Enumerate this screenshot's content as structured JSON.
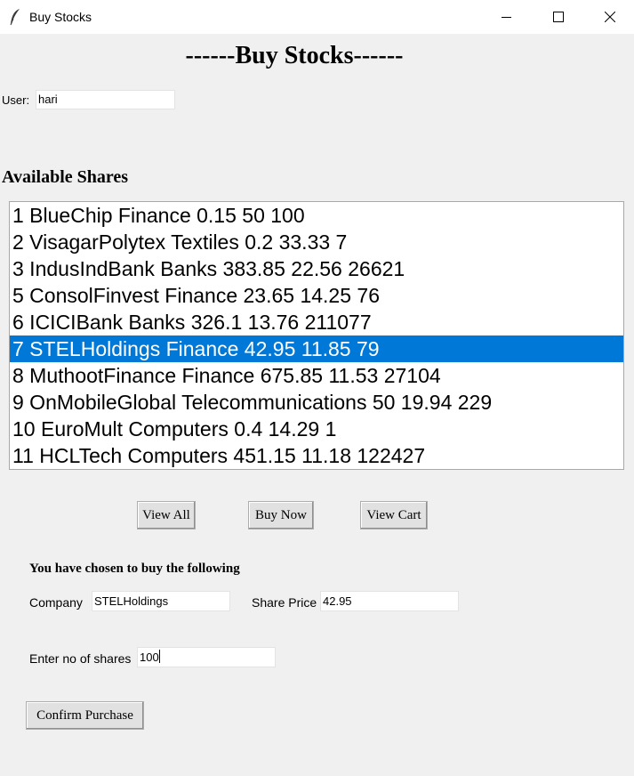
{
  "window": {
    "title": "Buy Stocks",
    "icon": "feather-icon",
    "controls": [
      "minimize-icon",
      "maximize-icon",
      "close-icon"
    ]
  },
  "heading": "------Buy Stocks------",
  "user": {
    "label": "User:",
    "value": "hari"
  },
  "shares": {
    "title": "Available Shares",
    "items": [
      "1 BlueChip Finance 0.15 50 100",
      "2 VisagarPolytex Textiles 0.2 33.33 7",
      "3 IndusIndBank Banks 383.85 22.56 26621",
      "5 ConsolFinvest Finance 23.65 14.25 76",
      "6 ICICIBank Banks 326.1 13.76 211077",
      "7 STELHoldings Finance 42.95 11.85 79",
      "8 MuthootFinance Finance 675.85 11.53 27104",
      "9 OnMobileGlobal Telecommunications 50 19.94 229",
      "10 EuroMult Computers 0.4 14.29 1",
      "11 HCLTech Computers 451.15 11.18 122427"
    ],
    "selected_index": 5,
    "selection_color": "#0078d7"
  },
  "buttons": {
    "view_all": "View All",
    "buy_now": "Buy Now",
    "view_cart": "View Cart",
    "confirm": "Confirm Purchase"
  },
  "purchase": {
    "title": "You have chosen to buy the following",
    "company_label": "Company",
    "company_value": "STELHoldings",
    "price_label": "Share Price",
    "price_value": "42.95",
    "qty_label": "Enter no of shares",
    "qty_value": "100"
  }
}
